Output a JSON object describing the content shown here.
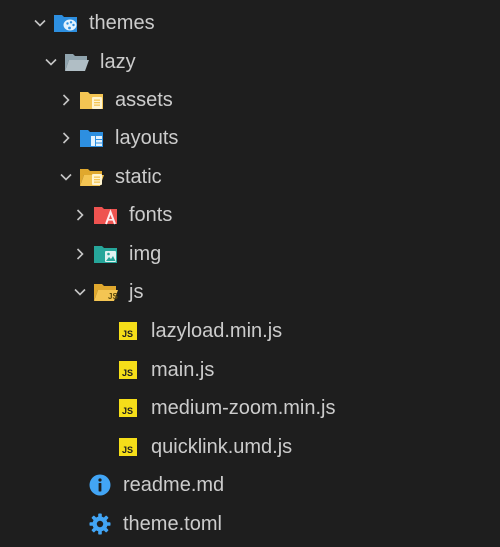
{
  "explorer": {
    "items": [
      {
        "label": "themes",
        "type": "folder",
        "expanded": true,
        "icon": "themes-folder-icon"
      },
      {
        "label": "lazy",
        "type": "folder",
        "expanded": true,
        "icon": "folder-open-icon"
      },
      {
        "label": "assets",
        "type": "folder",
        "expanded": false,
        "icon": "assets-folder-icon"
      },
      {
        "label": "layouts",
        "type": "folder",
        "expanded": false,
        "icon": "layouts-folder-icon"
      },
      {
        "label": "static",
        "type": "folder",
        "expanded": true,
        "icon": "static-folder-icon"
      },
      {
        "label": "fonts",
        "type": "folder",
        "expanded": false,
        "icon": "fonts-folder-icon"
      },
      {
        "label": "img",
        "type": "folder",
        "expanded": false,
        "icon": "images-folder-icon"
      },
      {
        "label": "js",
        "type": "folder",
        "expanded": true,
        "icon": "js-folder-icon"
      },
      {
        "label": "lazyload.min.js",
        "type": "file",
        "icon": "js-file-icon"
      },
      {
        "label": "main.js",
        "type": "file",
        "icon": "js-file-icon"
      },
      {
        "label": "medium-zoom.min.js",
        "type": "file",
        "icon": "js-file-icon"
      },
      {
        "label": "quicklink.umd.js",
        "type": "file",
        "icon": "js-file-icon"
      },
      {
        "label": "readme.md",
        "type": "file",
        "icon": "info-icon"
      },
      {
        "label": "theme.toml",
        "type": "file",
        "icon": "gear-icon"
      }
    ]
  },
  "colors": {
    "background": "#1e1e1e",
    "text": "#cccccc",
    "twisty": "#c5c5c5",
    "folder_yellow": "#f4c553",
    "folder_blue": "#2d8fe0",
    "folder_grey": "#90a4ae",
    "fonts_red": "#ef5350",
    "img_teal": "#26a69a",
    "js_yellow": "#f5de19",
    "info_blue": "#42a5f5"
  }
}
